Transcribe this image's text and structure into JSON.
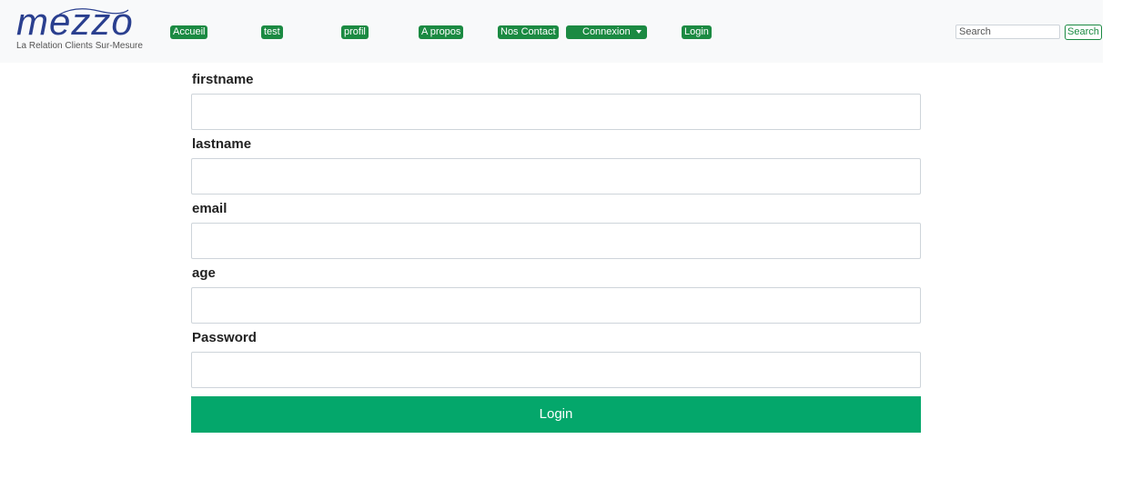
{
  "logo": {
    "wordmark": "mezzo",
    "tagline": "La Relation Clients Sur-Mesure"
  },
  "nav": {
    "items": [
      {
        "label": "Accueil"
      },
      {
        "label": "test"
      },
      {
        "label": "profil"
      },
      {
        "label": "A propos"
      },
      {
        "label": "Nos Contact"
      },
      {
        "label": "Connexion"
      },
      {
        "label": "Login"
      }
    ],
    "dropdown_icon": "caret-down-icon"
  },
  "search": {
    "placeholder": "Search",
    "button_label": "Search"
  },
  "form": {
    "fields": [
      {
        "label": "firstname",
        "value": ""
      },
      {
        "label": "lastname",
        "value": ""
      },
      {
        "label": "email",
        "value": ""
      },
      {
        "label": "age",
        "value": ""
      },
      {
        "label": "Password",
        "value": ""
      }
    ],
    "submit_label": "Login"
  },
  "colors": {
    "nav_green": "#1b8a42",
    "submit_green": "#04a76b",
    "logo_blue": "#2a3f8f"
  }
}
